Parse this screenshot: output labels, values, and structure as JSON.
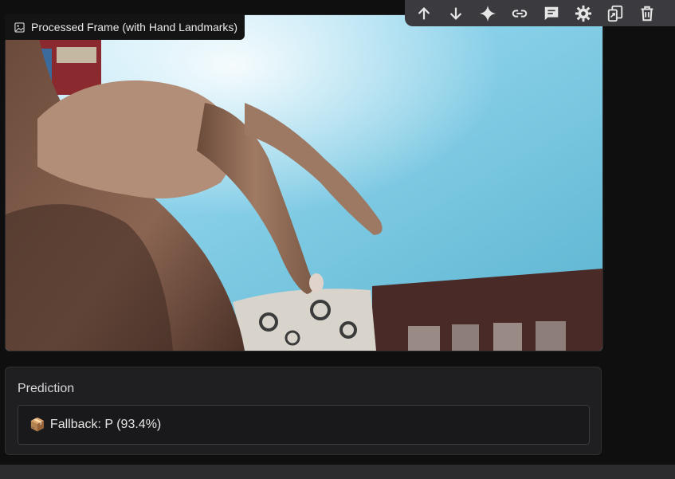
{
  "image_block": {
    "label": "Processed Frame (with Hand Landmarks)",
    "label_icon": "image-icon",
    "tools": [
      "fullscreen-icon",
      "download-icon"
    ]
  },
  "toolbar": {
    "buttons": [
      {
        "name": "move-up-icon"
      },
      {
        "name": "move-down-icon"
      },
      {
        "name": "ai-sparkle-icon"
      },
      {
        "name": "link-icon"
      },
      {
        "name": "comment-icon"
      },
      {
        "name": "settings-icon"
      },
      {
        "name": "mirror-cell-icon"
      },
      {
        "name": "delete-icon"
      },
      {
        "name": "more-icon"
      }
    ]
  },
  "prediction": {
    "title": "Prediction",
    "icon": "📦",
    "value": "Fallback: P (93.4%)"
  },
  "colors": {
    "background": "#0f0f10",
    "panel": "#1f1f21",
    "toolbar": "#3b3b3f"
  }
}
